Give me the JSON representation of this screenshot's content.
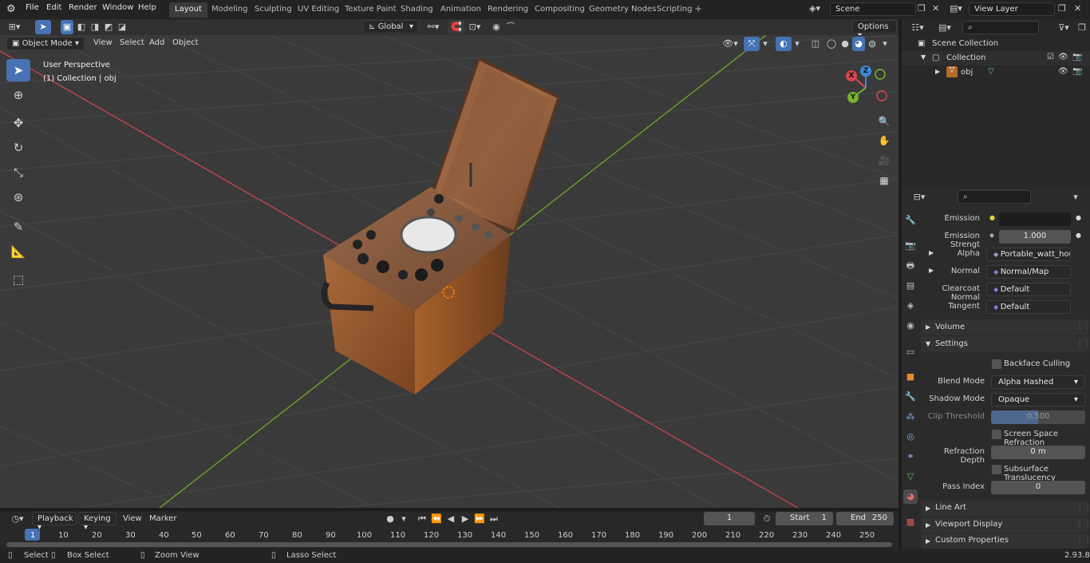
{
  "menu": {
    "file": "File",
    "edit": "Edit",
    "render": "Render",
    "window": "Window",
    "help": "Help"
  },
  "workspaces": [
    "Layout",
    "Modeling",
    "Sculpting",
    "UV Editing",
    "Texture Paint",
    "Shading",
    "Animation",
    "Rendering",
    "Compositing",
    "Geometry Nodes",
    "Scripting"
  ],
  "active_workspace": "Layout",
  "scene": {
    "name": "Scene",
    "view_layer": "View Layer"
  },
  "viewport_header": {
    "mode": "Object Mode",
    "view": "View",
    "select": "Select",
    "add": "Add",
    "object": "Object",
    "transform": "Global",
    "options": "Options"
  },
  "viewport": {
    "line1": "User Perspective",
    "line2": "(1) Collection | obj"
  },
  "gizmo": {
    "x": "X",
    "y": "Y",
    "z": "Z"
  },
  "outliner": {
    "scene_collection": "Scene Collection",
    "collection": "Collection",
    "object": "obj"
  },
  "properties": {
    "emission_label": "Emission",
    "emission_strength_label": "Emission Strengt",
    "emission_strength": "1.000",
    "alpha_label": "Alpha",
    "alpha_value": "Portable_watt_hourt...",
    "normal_label": "Normal",
    "normal_value": "Normal/Map",
    "clearcoat_label": "Clearcoat Normal",
    "clearcoat_value": "Default",
    "tangent_label": "Tangent",
    "tangent_value": "Default",
    "volume": "Volume",
    "settings": "Settings",
    "backface": "Backface Culling",
    "blend_label": "Blend Mode",
    "blend_value": "Alpha Hashed",
    "shadow_label": "Shadow Mode",
    "shadow_value": "Opaque",
    "clip_label": "Clip Threshold",
    "clip_value": "0.500",
    "ssr": "Screen Space Refraction",
    "refr_label": "Refraction Depth",
    "refr_value": "0 m",
    "sss": "Subsurface Translucency",
    "pass_label": "Pass Index",
    "pass_value": "0",
    "line_art": "Line Art",
    "viewport_display": "Viewport Display",
    "custom_props": "Custom Properties"
  },
  "timeline": {
    "playback": "Playback",
    "keying": "Keying",
    "view": "View",
    "marker": "Marker",
    "current": "1",
    "start_label": "Start",
    "start": "1",
    "end_label": "End",
    "end": "250",
    "ticks": [
      "1",
      "10",
      "20",
      "30",
      "40",
      "50",
      "60",
      "70",
      "80",
      "90",
      "100",
      "110",
      "120",
      "130",
      "140",
      "150",
      "160",
      "170",
      "180",
      "190",
      "200",
      "210",
      "220",
      "230",
      "240",
      "250"
    ]
  },
  "status": {
    "select": "Select",
    "box_select": "Box Select",
    "zoom_view": "Zoom View",
    "lasso_select": "Lasso Select",
    "version": "2.93.8"
  },
  "colors": {
    "accent": "#4772b3",
    "x_axis": "#d9454f",
    "y_axis": "#77b32c",
    "z_axis": "#3e88d8"
  }
}
